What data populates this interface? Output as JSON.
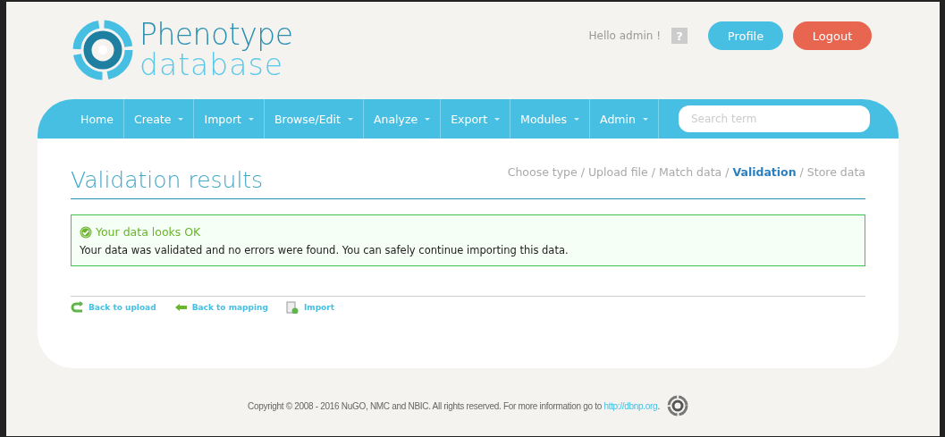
{
  "header": {
    "logo": {
      "line_1": "Phenotype",
      "line_2": "database"
    },
    "greeting": "Hello admin !",
    "help": "?",
    "buttons": [
      {
        "label": "Profile",
        "kind": "primary"
      },
      {
        "label": "Logout",
        "kind": "danger"
      }
    ]
  },
  "nav": {
    "items": [
      {
        "label": "Home",
        "dropdown": false
      },
      {
        "label": "Create",
        "dropdown": true
      },
      {
        "label": "Import",
        "dropdown": true
      },
      {
        "label": "Browse/Edit",
        "dropdown": true
      },
      {
        "label": "Analyze",
        "dropdown": true
      },
      {
        "label": "Export",
        "dropdown": true
      },
      {
        "label": "Modules",
        "dropdown": true
      },
      {
        "label": "Admin",
        "dropdown": true
      }
    ],
    "search": {
      "placeholder": "Search term"
    }
  },
  "page": {
    "title": "Validation results",
    "steps": [
      {
        "label": "Choose type",
        "selected": false
      },
      {
        "label": "Upload file",
        "selected": false
      },
      {
        "label": "Match data",
        "selected": false
      },
      {
        "label": "Validation",
        "selected": true
      },
      {
        "label": "Store data",
        "selected": false
      }
    ],
    "separator": "/",
    "message": {
      "title": "Your data looks OK",
      "text": "Your data was validated and no errors were found. You can safely continue importing this data."
    },
    "actions": [
      {
        "label": "Back to upload",
        "kind": "back-upload"
      },
      {
        "label": "Back to mapping",
        "kind": "back-mapping"
      },
      {
        "label": "Import",
        "kind": "import"
      }
    ]
  },
  "footer": {
    "text": "Copyright © 2008 - 2016 NuGO, NMC and NBIC. All rights reserved. For more information go to ",
    "link": "http://dbnp.org",
    "end": "."
  }
}
